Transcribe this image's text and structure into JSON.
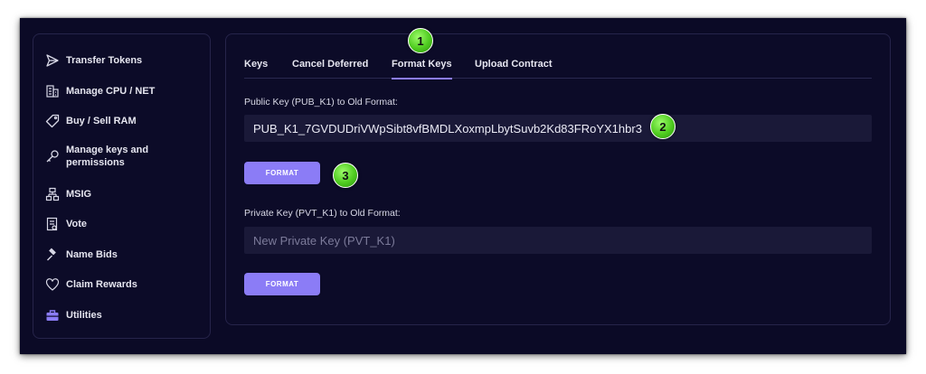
{
  "sidebar": {
    "items": [
      {
        "label": "Transfer Tokens",
        "icon": "send-icon"
      },
      {
        "label": "Manage CPU / NET",
        "icon": "building-icon"
      },
      {
        "label": "Buy / Sell RAM",
        "icon": "tag-icon"
      },
      {
        "label": "Manage keys and permissions",
        "icon": "key-icon"
      },
      {
        "label": "MSIG",
        "icon": "hierarchy-icon"
      },
      {
        "label": "Vote",
        "icon": "ballot-icon"
      },
      {
        "label": "Name Bids",
        "icon": "gavel-icon"
      },
      {
        "label": "Claim Rewards",
        "icon": "heart-icon"
      },
      {
        "label": "Utilities",
        "icon": "toolbox-icon",
        "active": true
      }
    ]
  },
  "tabs": [
    {
      "label": "Keys"
    },
    {
      "label": "Cancel Deferred"
    },
    {
      "label": "Format Keys",
      "active": true
    },
    {
      "label": "Upload Contract"
    }
  ],
  "public_key": {
    "label": "Public Key (PUB_K1) to Old Format:",
    "value": "PUB_K1_7GVDUDriVWpSibt8vfBMDLXoxmpLbytSuvb2Kd83FRoYX1hbr3",
    "button": "FORMAT"
  },
  "private_key": {
    "label": "Private Key (PVT_K1) to Old Format:",
    "placeholder": "New Private Key (PVT_K1)",
    "value": "",
    "button": "FORMAT"
  },
  "step_badges": [
    "1",
    "2",
    "3"
  ],
  "colors": {
    "background": "#0b0a26",
    "accent": "#8b7cf6",
    "input_bg": "#1a1938",
    "badge_green": "#4ecb1f"
  }
}
